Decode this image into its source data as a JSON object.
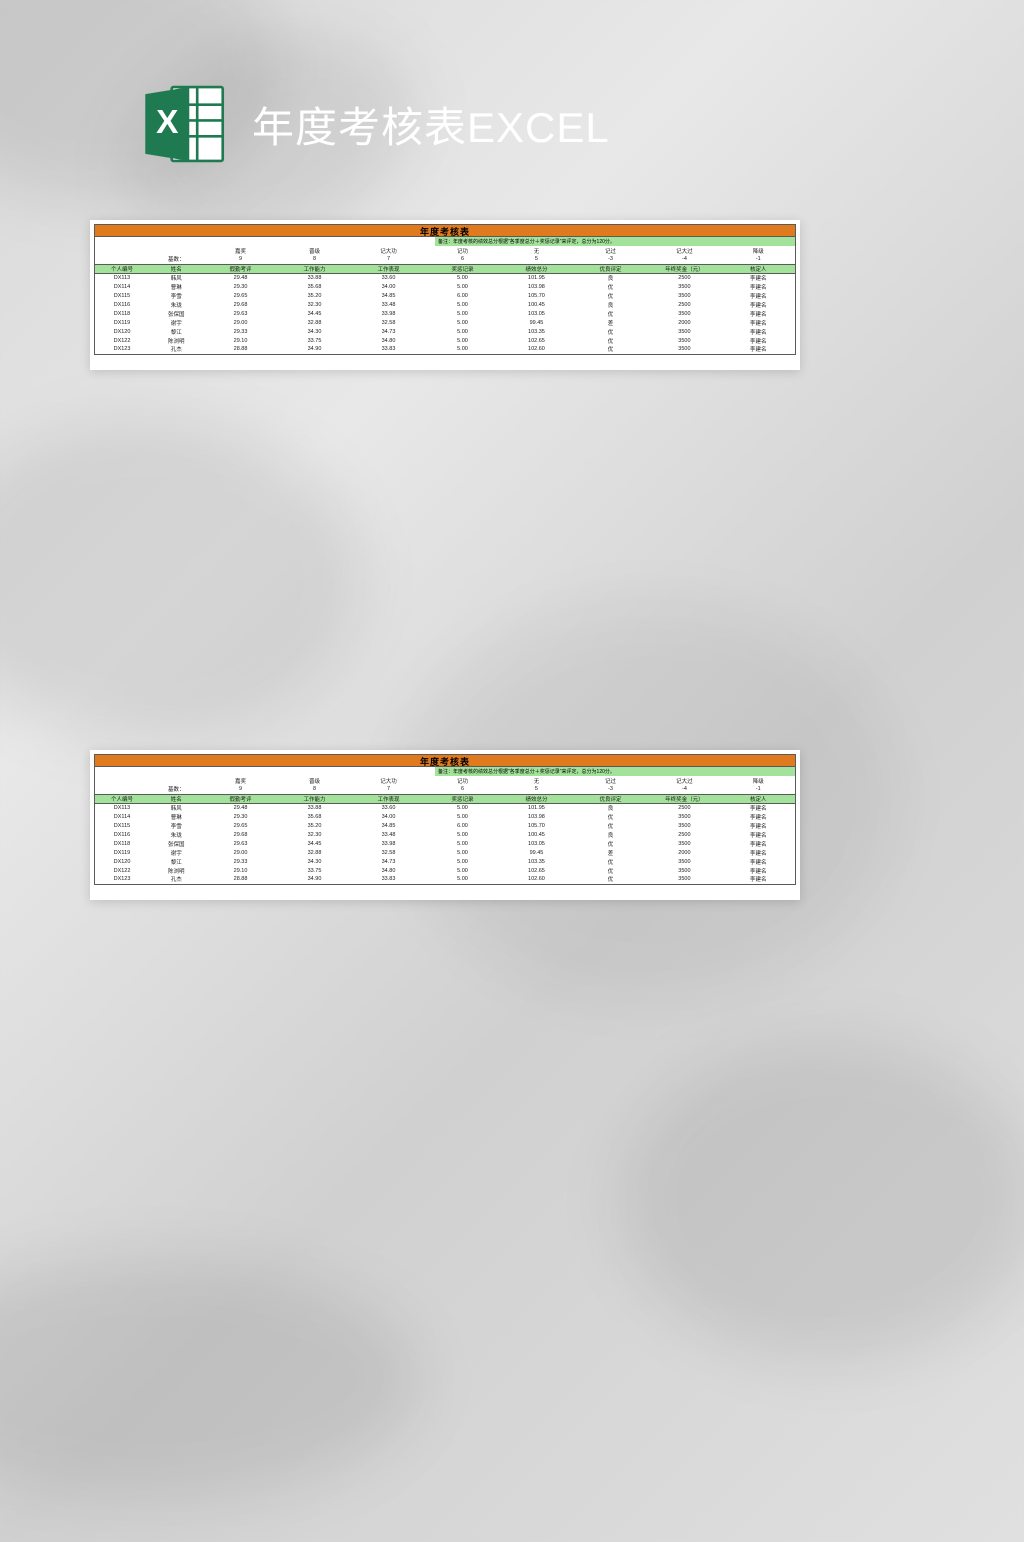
{
  "header": {
    "title": "年度考核表EXCEL"
  },
  "sheet": {
    "title": "年度考核表",
    "note": "备注：年度考核的绩效总分根据\"各季度总分＋奖惩记录\"来评定，总分为120分。",
    "cat_labels": [
      "嘉奖",
      "晋级",
      "记大功",
      "记功",
      "无",
      "记过",
      "记大过",
      "降级"
    ],
    "base_label": "基数：",
    "base_values": [
      "9",
      "8",
      "7",
      "6",
      "5",
      "-3",
      "-4",
      "-1"
    ],
    "columns": [
      "个人编号",
      "姓名",
      "假勤考评",
      "工作能力",
      "工作表现",
      "奖惩记录",
      "绩效总分",
      "优良评定",
      "年终奖金（元）",
      "核定人"
    ],
    "rows": [
      {
        "id": "DX113",
        "name": "韩风",
        "attend": "29.48",
        "ability": "33.88",
        "perf": "33.60",
        "reward": "5.00",
        "total": "101.95",
        "rating": "良",
        "bonus": "2500",
        "approver": "李建名"
      },
      {
        "id": "DX114",
        "name": "曹琳",
        "attend": "29.30",
        "ability": "35.68",
        "perf": "34.00",
        "reward": "5.00",
        "total": "103.98",
        "rating": "优",
        "bonus": "3500",
        "approver": "李建名"
      },
      {
        "id": "DX115",
        "name": "李雪",
        "attend": "29.65",
        "ability": "35.20",
        "perf": "34.85",
        "reward": "6.00",
        "total": "105.70",
        "rating": "优",
        "bonus": "3500",
        "approver": "李建名"
      },
      {
        "id": "DX116",
        "name": "朱珑",
        "attend": "29.68",
        "ability": "32.30",
        "perf": "33.48",
        "reward": "5.00",
        "total": "100.45",
        "rating": "良",
        "bonus": "2500",
        "approver": "李建名"
      },
      {
        "id": "DX118",
        "name": "张保国",
        "attend": "29.63",
        "ability": "34.45",
        "perf": "33.98",
        "reward": "5.00",
        "total": "103.05",
        "rating": "优",
        "bonus": "3500",
        "approver": "李建名"
      },
      {
        "id": "DX119",
        "name": "谢宇",
        "attend": "29.00",
        "ability": "32.88",
        "perf": "32.58",
        "reward": "5.00",
        "total": "99.45",
        "rating": "差",
        "bonus": "2000",
        "approver": "李建名"
      },
      {
        "id": "DX120",
        "name": "黎江",
        "attend": "29.33",
        "ability": "34.30",
        "perf": "34.73",
        "reward": "5.00",
        "total": "103.35",
        "rating": "优",
        "bonus": "3500",
        "approver": "李建名"
      },
      {
        "id": "DX122",
        "name": "陈浏明",
        "attend": "29.10",
        "ability": "33.75",
        "perf": "34.80",
        "reward": "5.00",
        "total": "102.65",
        "rating": "优",
        "bonus": "3500",
        "approver": "李建名"
      },
      {
        "id": "DX123",
        "name": "孔杰",
        "attend": "28.88",
        "ability": "34.90",
        "perf": "33.83",
        "reward": "5.00",
        "total": "102.60",
        "rating": "优",
        "bonus": "3500",
        "approver": "李建名"
      }
    ]
  },
  "chart_data": {
    "type": "table",
    "title": "年度考核表",
    "columns": [
      "个人编号",
      "姓名",
      "假勤考评",
      "工作能力",
      "工作表现",
      "奖惩记录",
      "绩效总分",
      "优良评定",
      "年终奖金（元）",
      "核定人"
    ],
    "rows": [
      [
        "DX113",
        "韩风",
        29.48,
        33.88,
        33.6,
        5.0,
        101.95,
        "良",
        2500,
        "李建名"
      ],
      [
        "DX114",
        "曹琳",
        29.3,
        35.68,
        34.0,
        5.0,
        103.98,
        "优",
        3500,
        "李建名"
      ],
      [
        "DX115",
        "李雪",
        29.65,
        35.2,
        34.85,
        6.0,
        105.7,
        "优",
        3500,
        "李建名"
      ],
      [
        "DX116",
        "朱珑",
        29.68,
        32.3,
        33.48,
        5.0,
        100.45,
        "良",
        2500,
        "李建名"
      ],
      [
        "DX118",
        "张保国",
        29.63,
        34.45,
        33.98,
        5.0,
        103.05,
        "优",
        3500,
        "李建名"
      ],
      [
        "DX119",
        "谢宇",
        29.0,
        32.88,
        32.58,
        5.0,
        99.45,
        "差",
        2000,
        "李建名"
      ],
      [
        "DX120",
        "黎江",
        29.33,
        34.3,
        34.73,
        5.0,
        103.35,
        "优",
        3500,
        "李建名"
      ],
      [
        "DX122",
        "陈浏明",
        29.1,
        33.75,
        34.8,
        5.0,
        102.65,
        "优",
        3500,
        "李建名"
      ],
      [
        "DX123",
        "孔杰",
        28.88,
        34.9,
        33.83,
        5.0,
        102.6,
        "优",
        3500,
        "李建名"
      ]
    ],
    "reward_base": {
      "嘉奖": 9,
      "晋级": 8,
      "记大功": 7,
      "记功": 6,
      "无": 5,
      "记过": -3,
      "记大过": -4,
      "降级": -1
    },
    "note": "年度考核的绩效总分根据各季度总分＋奖惩记录来评定，总分为120分。"
  }
}
